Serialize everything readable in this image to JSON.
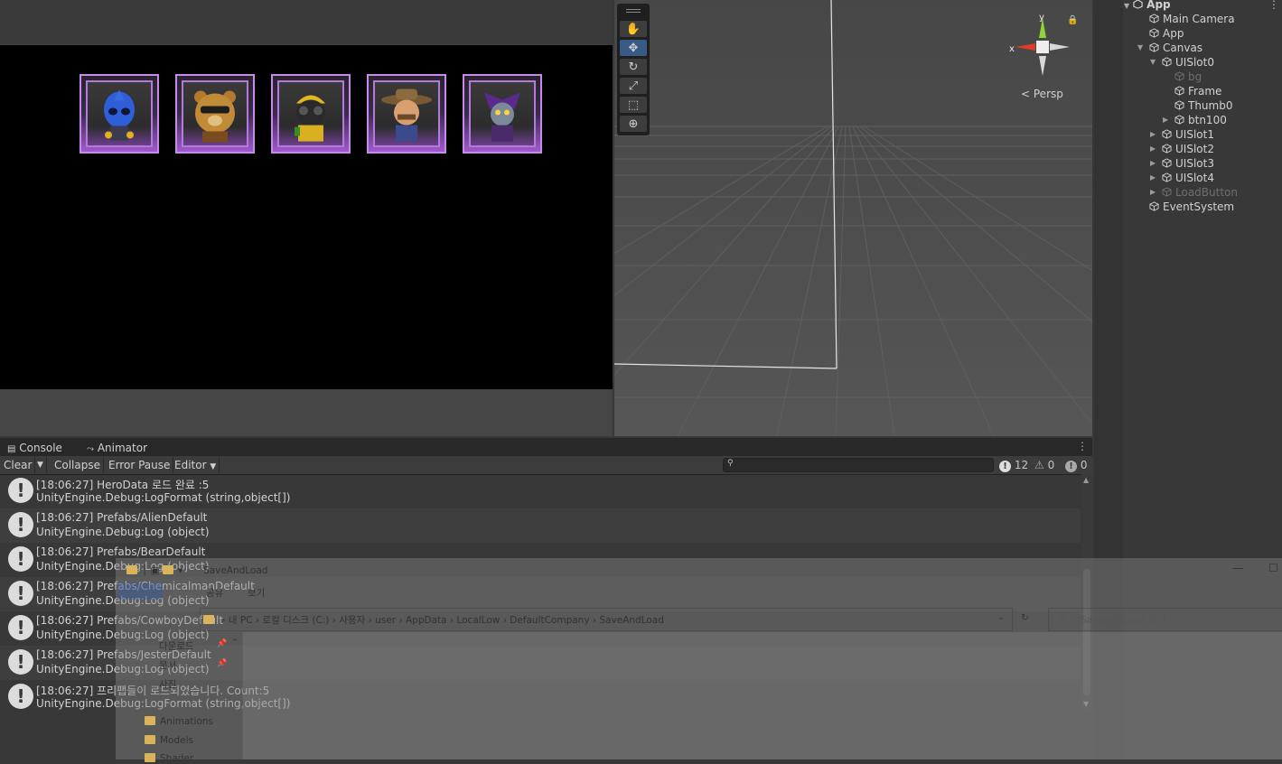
{
  "game": {
    "slots": [
      "Alien",
      "Bear",
      "Chemicalman",
      "Cowboy",
      "Jester"
    ]
  },
  "scene": {
    "persp_label": "Persp",
    "axis_x": "x",
    "axis_y": "y",
    "tools": [
      "hand-tool",
      "move-tool",
      "rotate-tool",
      "scale-tool",
      "rect-tool",
      "transform-tool"
    ]
  },
  "hierarchy": {
    "root": "App",
    "items": [
      {
        "label": "Main Camera",
        "dim": false
      },
      {
        "label": "App",
        "dim": false
      },
      {
        "label": "Canvas",
        "dim": false
      },
      {
        "label": "UISlot0",
        "dim": false
      },
      {
        "label": "bg",
        "dim": true
      },
      {
        "label": "Frame",
        "dim": false
      },
      {
        "label": "Thumb0",
        "dim": false
      },
      {
        "label": "btn100",
        "dim": false
      },
      {
        "label": "UISlot1",
        "dim": false
      },
      {
        "label": "UISlot2",
        "dim": false
      },
      {
        "label": "UISlot3",
        "dim": false
      },
      {
        "label": "UISlot4",
        "dim": false
      },
      {
        "label": "LoadButton",
        "dim": true
      },
      {
        "label": "EventSystem",
        "dim": false
      }
    ]
  },
  "console": {
    "tabs": [
      "Console",
      "Animator"
    ],
    "toolbar": {
      "clear": "Clear",
      "collapse": "Collapse",
      "error_pause": "Error Pause",
      "editor": "Editor"
    },
    "counts": {
      "info": "12",
      "warn": "0",
      "error": "0"
    },
    "logs": [
      {
        "line1": "[18:06:27] HeroData 로드 완료 :5",
        "line2": "UnityEngine.Debug:LogFormat (string,object[])"
      },
      {
        "line1": "[18:06:27] Prefabs/AlienDefault",
        "line2": "UnityEngine.Debug:Log (object)"
      },
      {
        "line1": "[18:06:27] Prefabs/BearDefault",
        "line2": "UnityEngine.Debug:Log (object)"
      },
      {
        "line1": "[18:06:27] Prefabs/ChemicalmanDefault",
        "line2": "UnityEngine.Debug:Log (object)"
      },
      {
        "line1": "[18:06:27] Prefabs/CowboyDefault",
        "line2": "UnityEngine.Debug:Log (object)"
      },
      {
        "line1": "[18:06:27] Prefabs/JesterDefault",
        "line2": "UnityEngine.Debug:Log (object)"
      },
      {
        "line1": "[18:06:27] 프리팹들이 로드되었습니다. Count:5",
        "line2": "UnityEngine.Debug:LogFormat (string,object[])"
      }
    ]
  },
  "explorer": {
    "title": "SaveAndLoad",
    "ribbon": [
      "공유",
      "보기"
    ],
    "path": [
      "내 PC",
      "로컬 디스크 (C:)",
      "사용자",
      "user",
      "AppData",
      "LocalLow",
      "DefaultCompany",
      "SaveAndLoad"
    ],
    "search_placeholder": "SaveAndLoad 검색",
    "quick": [
      "다운로드",
      "문서",
      "사진"
    ],
    "folders": [
      "Animations",
      "Models",
      "Shader"
    ]
  }
}
